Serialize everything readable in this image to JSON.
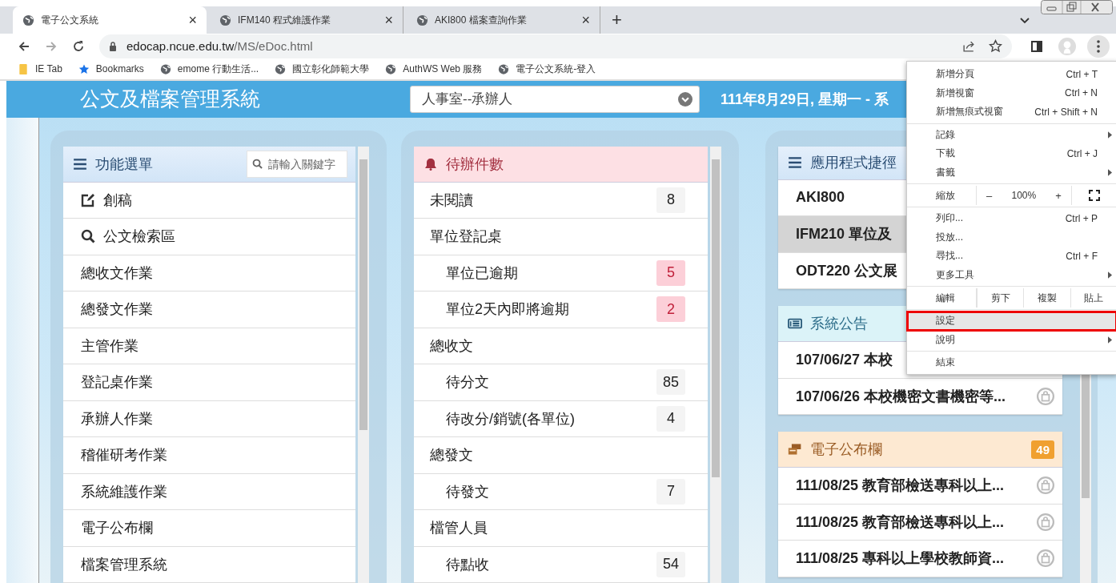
{
  "browser": {
    "tabs": [
      {
        "title": "電子公文系統",
        "selected": true,
        "close": "×"
      },
      {
        "title": "IFM140 程式維護作業",
        "selected": false,
        "close": "×"
      },
      {
        "title": "AKI800 檔案查詢作業",
        "selected": false,
        "close": "×"
      }
    ],
    "new_tab": "+",
    "url": {
      "host": "edocap.ncue.edu.tw",
      "path": "/MS/eDoc.html"
    },
    "bookmarks": [
      {
        "label": "IE Tab",
        "kind": "folder"
      },
      {
        "label": "Bookmarks",
        "kind": "star"
      },
      {
        "label": "emome 行動生活...",
        "kind": "globe"
      },
      {
        "label": "國立彰化師範大學",
        "kind": "globe"
      },
      {
        "label": "AuthWS Web 服務",
        "kind": "globe"
      },
      {
        "label": "電子公文系統-登入",
        "kind": "globe"
      }
    ]
  },
  "header": {
    "title": "公文及檔案管理系統",
    "role": "人事室--承辦人",
    "date": "111年8月29日, 星期一 - 系"
  },
  "menu_panel": {
    "title": "功能選單",
    "search_placeholder": "請輸入關鍵字",
    "items": [
      {
        "label": "創稿",
        "kind": "edit"
      },
      {
        "label": "公文檢索區",
        "kind": "search"
      },
      {
        "label": "總收文作業",
        "kind": "plain"
      },
      {
        "label": "總發文作業",
        "kind": "plain"
      },
      {
        "label": "主管作業",
        "kind": "plain"
      },
      {
        "label": "登記桌作業",
        "kind": "plain"
      },
      {
        "label": "承辦人作業",
        "kind": "plain"
      },
      {
        "label": "稽催研考作業",
        "kind": "plain"
      },
      {
        "label": "系統維護作業",
        "kind": "plain"
      },
      {
        "label": "電子公布欄",
        "kind": "plain"
      },
      {
        "label": "檔案管理系統",
        "kind": "plain"
      }
    ]
  },
  "pending_panel": {
    "title": "待辦件數",
    "items": [
      {
        "label": "未閱讀",
        "count": "8",
        "alert": false
      },
      {
        "label": "單位登記桌",
        "children": [
          {
            "label": "單位已逾期",
            "count": "5",
            "alert": true
          },
          {
            "label": "單位2天內即將逾期",
            "count": "2",
            "alert": true
          }
        ]
      },
      {
        "label": "總收文",
        "children": [
          {
            "label": "待分文",
            "count": "85",
            "alert": false
          },
          {
            "label": "待改分/銷號(各單位)",
            "count": "4",
            "alert": false
          }
        ]
      },
      {
        "label": "總發文",
        "children": [
          {
            "label": "待發文",
            "count": "7",
            "alert": false
          }
        ]
      },
      {
        "label": "檔管人員",
        "children": [
          {
            "label": "待點收",
            "count": "54",
            "alert": false
          }
        ]
      }
    ]
  },
  "shortcuts": {
    "title": "應用程式捷徑",
    "items": [
      {
        "label": "AKI800",
        "selected": false
      },
      {
        "label": "IFM210 單位及",
        "selected": true
      },
      {
        "label": "ODT220 公文展",
        "selected": false
      }
    ]
  },
  "announcements": {
    "title": "系統公告",
    "items": [
      {
        "text": "107/06/27 本校",
        "icon": false
      },
      {
        "text": "107/06/26 本校機密文書機密等...",
        "icon": true
      }
    ]
  },
  "bulletin": {
    "title": "電子公布欄",
    "badge": "49",
    "items": [
      "111/08/25 教育部檢送專科以上...",
      "111/08/25 教育部檢送專科以上...",
      "111/08/25 專科以上學校教師資..."
    ]
  },
  "chrome_menu": {
    "sections": [
      [
        {
          "kind": "item",
          "label": "新增分頁",
          "shortcut": "Ctrl + T",
          "submenu": false,
          "selected": false
        },
        {
          "kind": "item",
          "label": "新增視窗",
          "shortcut": "Ctrl + N",
          "submenu": false,
          "selected": false
        },
        {
          "kind": "item",
          "label": "新增無痕式視窗",
          "shortcut": "Ctrl + Shift + N",
          "submenu": false,
          "selected": false
        }
      ],
      [
        {
          "kind": "item",
          "label": "記錄",
          "submenu": true,
          "selected": false
        },
        {
          "kind": "item",
          "label": "下載",
          "shortcut": "Ctrl + J",
          "submenu": false,
          "selected": false
        },
        {
          "kind": "item",
          "label": "書籤",
          "submenu": true,
          "selected": false
        }
      ],
      [
        {
          "kind": "zoom",
          "label": "縮放",
          "minus": "–",
          "value": "100%",
          "plus": "+"
        }
      ],
      [
        {
          "kind": "item",
          "label": "列印...",
          "shortcut": "Ctrl + P",
          "submenu": false,
          "selected": false
        },
        {
          "kind": "item",
          "label": "投放...",
          "submenu": false,
          "selected": false
        },
        {
          "kind": "item",
          "label": "尋找...",
          "shortcut": "Ctrl + F",
          "submenu": false,
          "selected": false
        },
        {
          "kind": "item",
          "label": "更多工具",
          "submenu": true,
          "selected": false
        }
      ],
      [
        {
          "kind": "edit",
          "label": "編輯",
          "cut": "剪下",
          "copy": "複製",
          "paste": "貼上"
        }
      ],
      [
        {
          "kind": "item",
          "label": "設定",
          "submenu": false,
          "selected": true
        },
        {
          "kind": "item",
          "label": "說明",
          "submenu": true,
          "selected": false
        }
      ],
      [
        {
          "kind": "item",
          "label": "結束",
          "submenu": false,
          "selected": false
        }
      ]
    ]
  }
}
